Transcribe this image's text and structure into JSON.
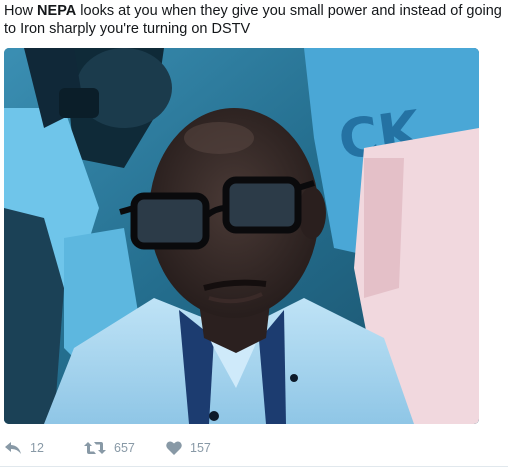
{
  "tweet": {
    "text_before": "How ",
    "text_bold": "NEPA",
    "text_after": " looks at you when they give you small power and instead of going to Iron sharply you're turning on DSTV"
  },
  "media": {
    "background_text": "CK"
  },
  "actions": {
    "replies": "12",
    "retweets": "657",
    "likes": "157"
  },
  "colors": {
    "action_gray": "#8899a6",
    "text": "#14171a"
  }
}
